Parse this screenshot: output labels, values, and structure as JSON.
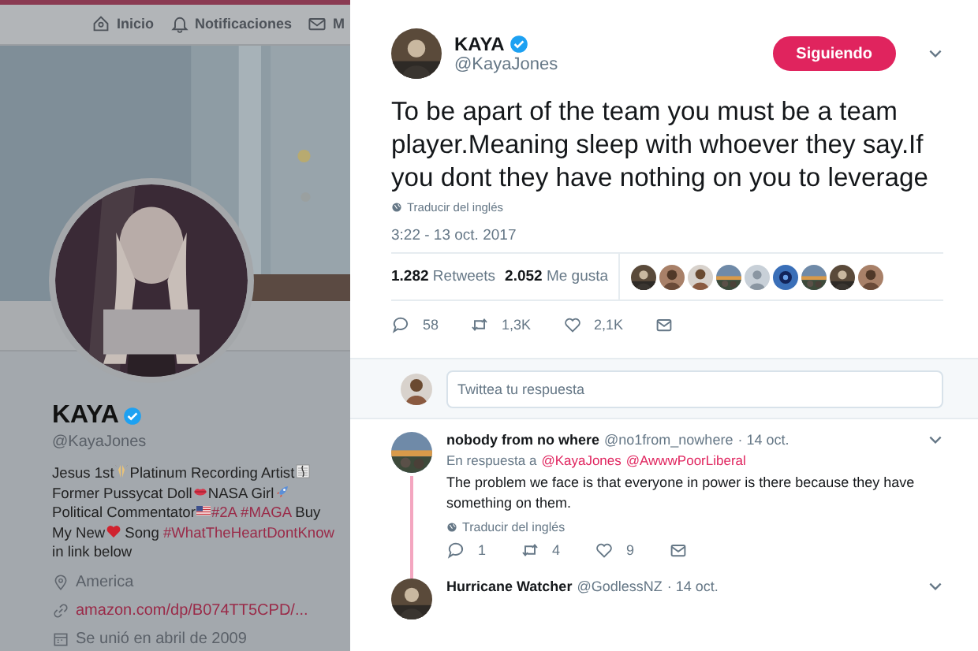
{
  "nav": [
    {
      "label": "Inicio"
    },
    {
      "label": "Notificaciones"
    },
    {
      "label": "M"
    }
  ],
  "profile": {
    "name": "KAYA",
    "verified": true,
    "handle": "@KayaJones",
    "bio": [
      {
        "kind": "text",
        "text": "Jesus 1st"
      },
      {
        "kind": "hands"
      },
      {
        "kind": "text",
        "text": "Platinum Recording Artist"
      },
      {
        "kind": "clef"
      },
      {
        "kind": "text",
        "text": " Former Pussycat Doll"
      },
      {
        "kind": "lips"
      },
      {
        "kind": "text",
        "text": "NASA Girl"
      },
      {
        "kind": "rocket"
      },
      {
        "kind": "text",
        "text": " Political Commentator"
      },
      {
        "kind": "flag"
      },
      {
        "kind": "hashtag",
        "text": "#2A #MAGA"
      },
      {
        "kind": "text",
        "text": " Buy My New"
      },
      {
        "kind": "heart"
      },
      {
        "kind": "text",
        "text": " Song "
      },
      {
        "kind": "hashtag",
        "text": "#WhatTheHeartDontKnow"
      },
      {
        "kind": "text",
        "text": " in link below"
      }
    ],
    "location": "America",
    "link": "amazon.com/dp/B074TT5CPD/...",
    "joined": "Se unió en abril de 2009"
  },
  "tweet": {
    "name": "KAYA",
    "verified": true,
    "handle": "@KayaJones",
    "follow": "Siguiendo",
    "following": true,
    "text": "To be apart of the team you must be a team player.Meaning sleep with whoever they say.If you dont they have nothing on you to leverage",
    "translate": "Traducir del inglés",
    "time": "3:22 - 13 oct. 2017",
    "retweets": {
      "count": "1.282",
      "label": "Retweets"
    },
    "likes": {
      "count": "2.052",
      "label": "Me gusta"
    },
    "actions": [
      {
        "kind": "reply",
        "count": "58"
      },
      {
        "kind": "retweet",
        "count": "1,3K"
      },
      {
        "kind": "like",
        "count": "2,1K"
      },
      {
        "kind": "message"
      }
    ]
  },
  "reply_box": {
    "placeholder": "Twittea tu respuesta"
  },
  "replies": [
    {
      "name": "nobody from no where",
      "handle": "@no1from_nowhere",
      "date": "· 14 oct.",
      "in_reply_label": "En respuesta a",
      "mentions": [
        "@KayaJones",
        "@AwwwPoorLiberal"
      ],
      "text": "The problem we face is that everyone in power is there because they have something on them.",
      "translate": "Traducir del inglés",
      "thread": true,
      "actions": [
        {
          "kind": "reply",
          "count": "1"
        },
        {
          "kind": "retweet",
          "count": "4"
        },
        {
          "kind": "like",
          "count": "9"
        },
        {
          "kind": "message"
        }
      ]
    },
    {
      "name": "Hurricane Watcher",
      "handle": "@GodlessNZ",
      "date": "· 14 oct.",
      "thread": false
    }
  ]
}
